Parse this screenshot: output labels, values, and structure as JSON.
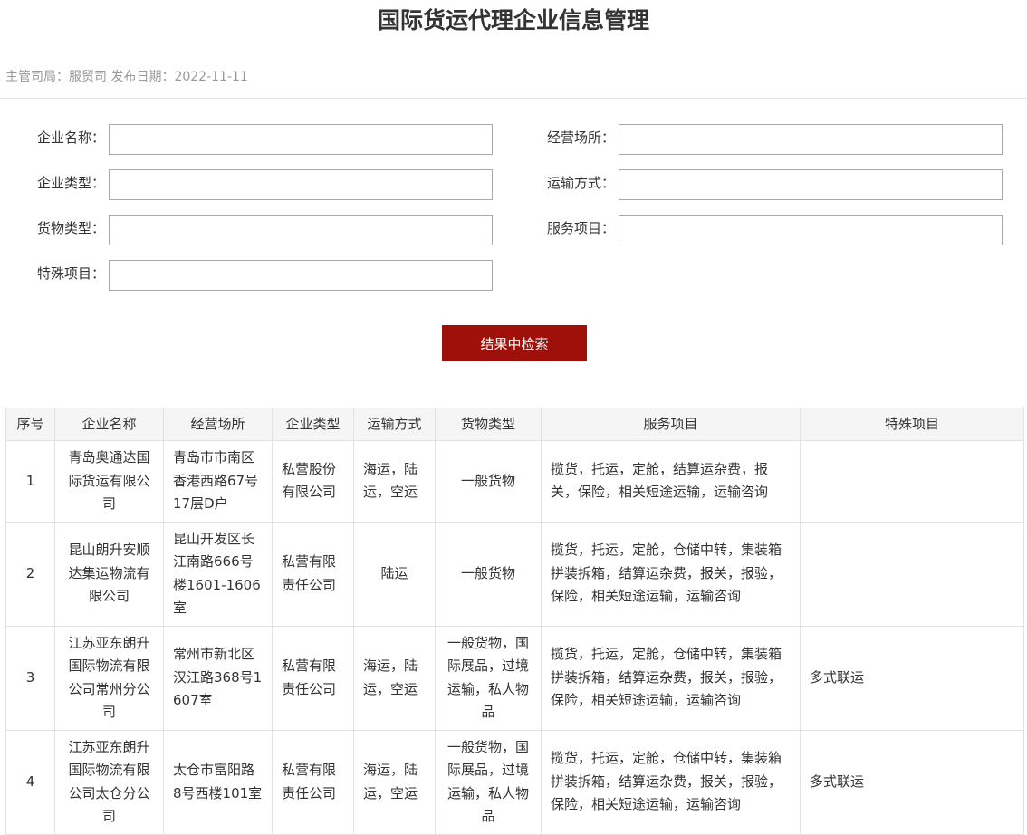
{
  "page": {
    "title": "国际货运代理企业信息管理",
    "meta": "主管司局：服贸司 发布日期：2022-11-11"
  },
  "form": {
    "company_name_label": "企业名称：",
    "business_place_label": "经营场所：",
    "company_type_label": "企业类型：",
    "transport_mode_label": "运输方式：",
    "cargo_type_label": "货物类型：",
    "service_items_label": "服务项目：",
    "special_items_label": "特殊项目：",
    "search_button": "结果中检索"
  },
  "table": {
    "headers": [
      "序号",
      "企业名称",
      "经营场所",
      "企业类型",
      "运输方式",
      "货物类型",
      "服务项目",
      "特殊项目"
    ],
    "rows": [
      [
        "1",
        "青岛奥通达国际货运有限公司",
        "青岛市市南区香港西路67号17层D户",
        "私营股份有限公司",
        "海运，陆运，空运",
        "一般货物",
        "揽货，托运，定舱，结算运杂费，报关，保险，相关短途运输，运输咨询",
        ""
      ],
      [
        "2",
        "昆山朗升安顺达集运物流有限公司",
        "昆山开发区长江南路666号楼1601-1606室",
        "私营有限责任公司",
        "陆运",
        "一般货物",
        "揽货，托运，定舱，仓储中转，集装箱拼装拆箱，结算运杂费，报关，报验，保险，相关短途运输，运输咨询",
        ""
      ],
      [
        "3",
        "江苏亚东朗升国际物流有限公司常州分公司",
        "常州市新北区汉江路368号1607室",
        "私营有限责任公司",
        "海运，陆运，空运",
        "一般货物，国际展品，过境运输，私人物品",
        "揽货，托运，定舱，仓储中转，集装箱拼装拆箱，结算运杂费，报关，报验，保险，相关短途运输，运输咨询",
        "多式联运"
      ],
      [
        "4",
        "江苏亚东朗升国际物流有限公司太仓分公司",
        "太仓市富阳路8号西楼101室",
        "私营有限责任公司",
        "海运，陆运，空运",
        "一般货物，国际展品，过境运输，私人物品",
        "揽货，托运，定舱，仓储中转，集装箱拼装拆箱，结算运杂费，报关，报验，保险，相关短途运输，运输咨询",
        "多式联运"
      ]
    ]
  }
}
